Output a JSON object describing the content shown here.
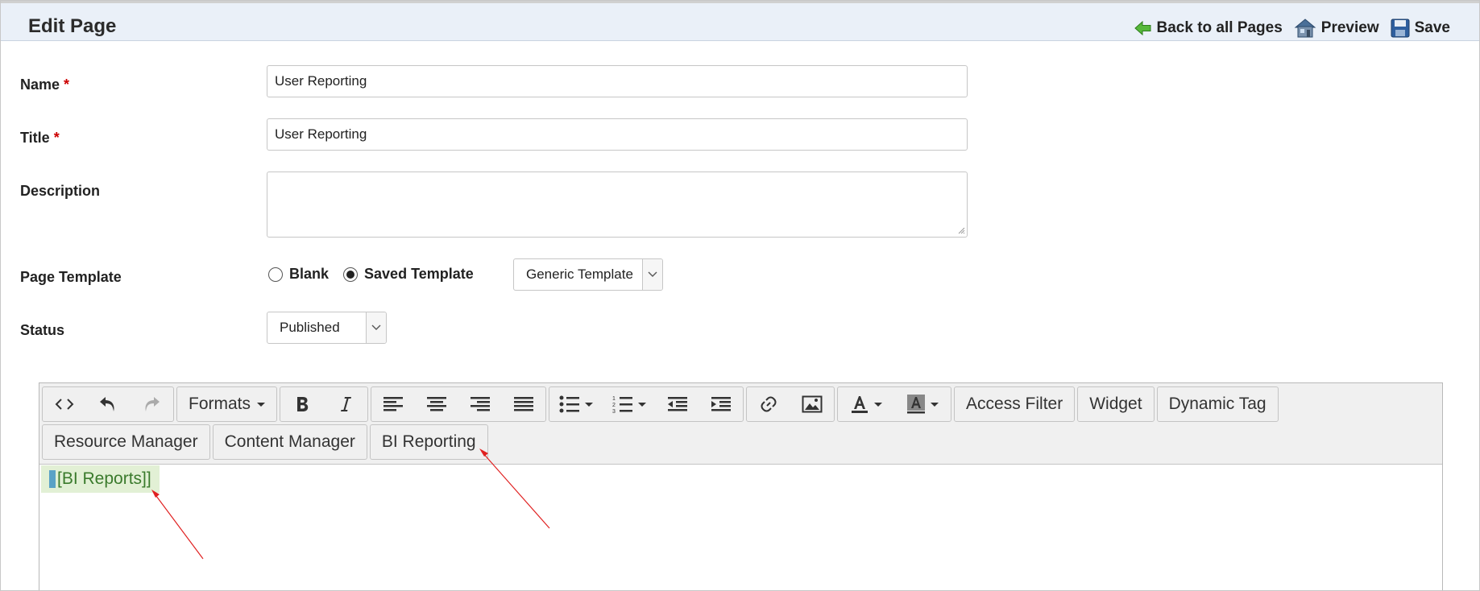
{
  "header": {
    "title": "Edit Page",
    "back_label": "Back to all Pages",
    "preview_label": "Preview",
    "save_label": "Save"
  },
  "form": {
    "name_label": "Name",
    "name_value": "User Reporting",
    "title_label": "Title",
    "title_value": "User Reporting",
    "required_mark": "*",
    "description_label": "Description",
    "description_value": "",
    "template_label": "Page Template",
    "template_options": [
      {
        "label": "Blank",
        "checked": false
      },
      {
        "label": "Saved Template",
        "checked": true
      }
    ],
    "template_select": "Generic Template",
    "status_label": "Status",
    "status_select": "Published"
  },
  "editor": {
    "toolbar": {
      "formats_label": "Formats",
      "access_filter_label": "Access Filter",
      "widget_label": "Widget",
      "dynamic_tag_label": "Dynamic Tag",
      "resource_manager_label": "Resource Manager",
      "content_manager_label": "Content Manager",
      "bi_reporting_label": "BI Reporting"
    },
    "content_text": "BI Reports]]",
    "content_prefix": "["
  },
  "colors": {
    "header_bg": "#eaf0f8",
    "tag_bg": "#e2f0d5",
    "tag_text": "#3a7a2c",
    "annotation_arrow": "#e02020",
    "required": "#cc0000"
  }
}
